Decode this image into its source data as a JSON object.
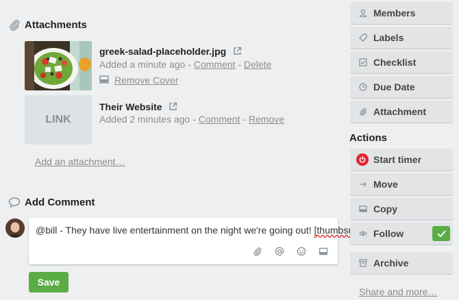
{
  "attachments": {
    "title": "Attachments",
    "items": [
      {
        "name": "greek-salad-placeholder.jpg",
        "meta_prefix": "Added a minute ago - ",
        "comment_label": "Comment",
        "separator": " - ",
        "action_label": "Delete",
        "cover_label": "Remove Cover",
        "thumb_icon": "salad-photo"
      },
      {
        "name": "Their Website",
        "meta_prefix": "Added 2 minutes ago - ",
        "comment_label": "Comment",
        "separator": " - ",
        "action_label": "Remove",
        "thumb_text": "LINK"
      }
    ],
    "add_label": "Add an attachment…"
  },
  "comment": {
    "title": "Add Comment",
    "text_before": "@bill - They have live entertainment on the night we're going out! ",
    "text_flagged": "[thumbsup]",
    "tools": [
      "paperclip-icon",
      "at-icon",
      "emoji-icon",
      "card-icon"
    ],
    "save_label": "Save"
  },
  "sidebar": {
    "add_items": [
      {
        "label": "Members",
        "icon": "person-icon"
      },
      {
        "label": "Labels",
        "icon": "tag-icon"
      },
      {
        "label": "Checklist",
        "icon": "checkbox-icon"
      },
      {
        "label": "Due Date",
        "icon": "clock-icon"
      },
      {
        "label": "Attachment",
        "icon": "paperclip-icon"
      }
    ],
    "actions_title": "Actions",
    "action_items": [
      {
        "label": "Start timer",
        "icon": "power-icon"
      },
      {
        "label": "Move",
        "icon": "arrow-right-icon"
      },
      {
        "label": "Copy",
        "icon": "copy-icon"
      },
      {
        "label": "Follow",
        "icon": "eye-icon",
        "checked": true
      },
      {
        "label": "Archive",
        "icon": "archive-icon"
      }
    ],
    "share_label": "Share and more…"
  },
  "colors": {
    "background": "#edeff0",
    "save_green": "#5aac44",
    "timer_red": "#e52430"
  }
}
